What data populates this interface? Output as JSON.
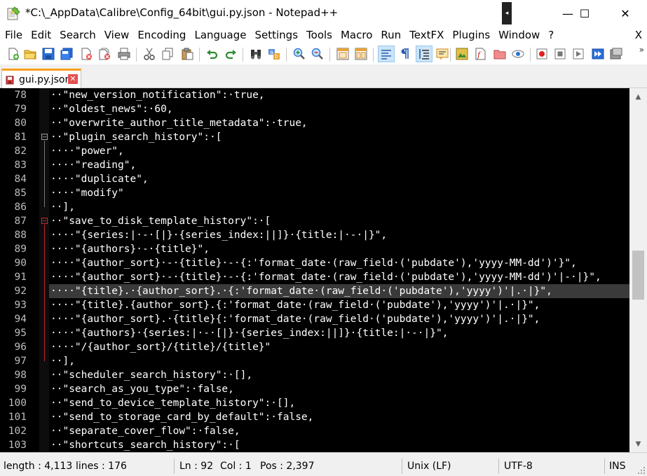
{
  "window": {
    "title": "*C:\\_AppData\\Calibre\\Config_64bit\\gui.py.json - Notepad++",
    "pin_glyph": "◂",
    "minimize_glyph": "—",
    "maximize_glyph": "☐",
    "close_glyph": "✕"
  },
  "menu": {
    "items": [
      "File",
      "Edit",
      "Search",
      "View",
      "Encoding",
      "Language",
      "Settings",
      "Tools",
      "Macro",
      "Run",
      "TextFX",
      "Plugins",
      "Window",
      "?"
    ],
    "close_label": "X"
  },
  "toolbar": {
    "buttons": [
      "new-file-icon",
      "open-folder-icon",
      "save-icon",
      "save-all-icon",
      "close-file-icon",
      "close-all-icon",
      "print-icon",
      "cut-icon",
      "copy-icon",
      "paste-icon",
      "undo-icon",
      "redo-icon",
      "find-icon",
      "replace-icon",
      "zoom-in-icon",
      "zoom-out-icon",
      "sync-vertical-icon",
      "sync-horizontal-icon",
      "word-wrap-icon",
      "show-all-chars-icon",
      "indent-guide-icon",
      "udl-icon",
      "doc-map-icon",
      "function-list-icon",
      "folder-workspace-icon",
      "monitor-icon",
      "record-macro-icon",
      "stop-macro-icon",
      "play-macro-icon",
      "run-macro-multiple-icon",
      "save-macro-icon"
    ],
    "more_glyph": "»"
  },
  "tab": {
    "label": "gui.py.json",
    "close_glyph": "✕"
  },
  "editor": {
    "current_line": 92,
    "lines": [
      {
        "n": "78",
        "text": "··\"new_version_notification\":·true,"
      },
      {
        "n": "79",
        "text": "··\"oldest_news\":·60,"
      },
      {
        "n": "80",
        "text": "··\"overwrite_author_title_metadata\":·true,"
      },
      {
        "n": "81",
        "text": "··\"plugin_search_history\":·["
      },
      {
        "n": "82",
        "text": "····\"power\","
      },
      {
        "n": "83",
        "text": "····\"reading\","
      },
      {
        "n": "84",
        "text": "····\"duplicate\","
      },
      {
        "n": "85",
        "text": "····\"modify\""
      },
      {
        "n": "86",
        "text": "··],"
      },
      {
        "n": "87",
        "text": "··\"save_to_disk_template_history\":·["
      },
      {
        "n": "88",
        "text": "····\"{series:|·-·[|}·{series_index:||]}·{title:|·-·|}\","
      },
      {
        "n": "89",
        "text": "····\"{authors}·-·{title}\","
      },
      {
        "n": "90",
        "text": "····\"{author_sort}·-·{title}·-·{:'format_date·(raw_field·('pubdate'),'yyyy-MM-dd')'}\","
      },
      {
        "n": "91",
        "text": "····\"{author_sort}·-·{title}·-·{:'format_date·(raw_field·('pubdate'),'yyyy-MM-dd')'|-·|}\","
      },
      {
        "n": "92",
        "text": "····\"{title}.·{author_sort}.·{:'format_date·(raw_field·('pubdate'),'yyyy')'|.·|}\","
      },
      {
        "n": "93",
        "text": "····\"{title}.{author_sort}.{:'format_date·(raw_field·('pubdate'),'yyyy')'|.·|}\","
      },
      {
        "n": "94",
        "text": "····\"{author_sort}.·{title}{:'format_date·(raw_field·('pubdate'),'yyyy')'|.·|}\","
      },
      {
        "n": "95",
        "text": "····\"{authors}·{series:|·-·[|}·{series_index:||]}·{title:|·-·|}\","
      },
      {
        "n": "96",
        "text": "····\"/{author_sort}/{title}/{title}\""
      },
      {
        "n": "97",
        "text": "··],"
      },
      {
        "n": "98",
        "text": "··\"scheduler_search_history\":·[],"
      },
      {
        "n": "99",
        "text": "··\"search_as_you_type\":·false,"
      },
      {
        "n": "100",
        "text": "··\"send_to_device_template_history\":·[],"
      },
      {
        "n": "101",
        "text": "··\"send_to_storage_card_by_default\":·false,"
      },
      {
        "n": "102",
        "text": "··\"separate_cover_flow\":·false,"
      },
      {
        "n": "103",
        "text": "··\"shortcuts_search_history\":·["
      }
    ]
  },
  "status": {
    "length": "length : 4,113",
    "lines": "lines : 176",
    "ln": "Ln : 92",
    "col": "Col : 1",
    "pos": "Pos : 2,397",
    "eol": "Unix (LF)",
    "encoding": "UTF-8",
    "mode": "INS"
  }
}
